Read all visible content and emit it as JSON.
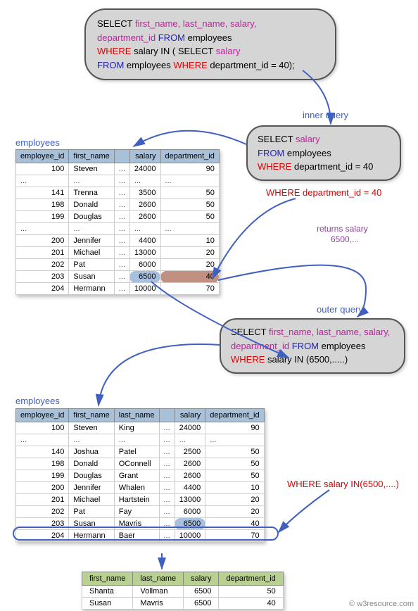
{
  "top_sql": {
    "line1a": "SELECT ",
    "line1b": "first_name, last_name, salary,",
    "line2a": "department_id ",
    "line2b": "FROM ",
    "line2c": "employees",
    "line3a": "WHERE ",
    "line3b": "salary IN ( ",
    "line3c": "SELECT ",
    "line3d": "salary",
    "line4a": "FROM ",
    "line4b": "employees ",
    "line4c": "WHERE ",
    "line4d": "department_id = 40",
    "line4e": ");"
  },
  "labels": {
    "inner_query": "inner query",
    "outer_query": "outer query",
    "employees1": "employees",
    "employees2": "employees",
    "where_dept40": "WHERE department_id = 40",
    "returns_salary": "returns salary",
    "returns_salary_val": "6500,...",
    "where_salary_in": "WHERE salary IN(6500,....)"
  },
  "inner_sql": {
    "l1a": "SELECT ",
    "l1b": "salary",
    "l2a": "FROM ",
    "l2b": "employees",
    "l3a": "WHERE ",
    "l3b": "department_id = 40"
  },
  "outer_sql": {
    "l1a": "SELECT ",
    "l1b": "first_name, last_name, salary,",
    "l2a": "department_id ",
    "l2b": "FROM ",
    "l2c": "employees",
    "l3a": "WHERE ",
    "l3b": "salary IN ",
    "l3c": "(6500,.....)"
  },
  "table1": {
    "headers": [
      "employee_id",
      "first_name",
      "",
      "salary",
      "department_id"
    ],
    "rows": [
      [
        "100",
        "Steven",
        "...",
        "24000",
        "90"
      ],
      [
        "...",
        "...",
        "...",
        "...",
        "..."
      ],
      [
        "141",
        "Trenna",
        "...",
        "3500",
        "50"
      ],
      [
        "198",
        "Donald",
        "...",
        "2600",
        "50"
      ],
      [
        "199",
        "Douglas",
        "...",
        "2600",
        "50"
      ],
      [
        "...",
        "...",
        "...",
        "...",
        "..."
      ],
      [
        "200",
        "Jennifer",
        "...",
        "4400",
        "10"
      ],
      [
        "201",
        "Michael",
        "...",
        "13000",
        "20"
      ],
      [
        "202",
        "Pat",
        "...",
        "6000",
        "20"
      ],
      [
        "203",
        "Susan",
        "...",
        "6500",
        "40"
      ],
      [
        "204",
        "Hermann",
        "...",
        "10000",
        "70"
      ]
    ]
  },
  "table2": {
    "headers": [
      "employee_id",
      "first_name",
      "last_name",
      "",
      "salary",
      "department_id"
    ],
    "rows": [
      [
        "100",
        "Steven",
        "King",
        "...",
        "24000",
        "90"
      ],
      [
        "...",
        "...",
        "...",
        "...",
        "...",
        "..."
      ],
      [
        "140",
        "Joshua",
        "Patel",
        "...",
        "2500",
        "50"
      ],
      [
        "198",
        "Donald",
        "OConnell",
        "...",
        "2600",
        "50"
      ],
      [
        "199",
        "Douglas",
        "Grant",
        "...",
        "2600",
        "50"
      ],
      [
        "200",
        "Jennifer",
        "Whalen",
        "...",
        "4400",
        "10"
      ],
      [
        "201",
        "Michael",
        "Hartstein",
        "...",
        "13000",
        "20"
      ],
      [
        "202",
        "Pat",
        "Fay",
        "...",
        "6000",
        "20"
      ],
      [
        "203",
        "Susan",
        "Mavris",
        "...",
        "6500",
        "40"
      ],
      [
        "204",
        "Hermann",
        "Baer",
        "...",
        "10000",
        "70"
      ]
    ]
  },
  "result": {
    "headers": [
      "first_name",
      "last_name",
      "salary",
      "department_id"
    ],
    "rows": [
      [
        "Shanta",
        "Vollman",
        "6500",
        "50"
      ],
      [
        "Susan",
        "Mavris",
        "6500",
        "40"
      ]
    ]
  },
  "watermark": "© w3resource.com"
}
